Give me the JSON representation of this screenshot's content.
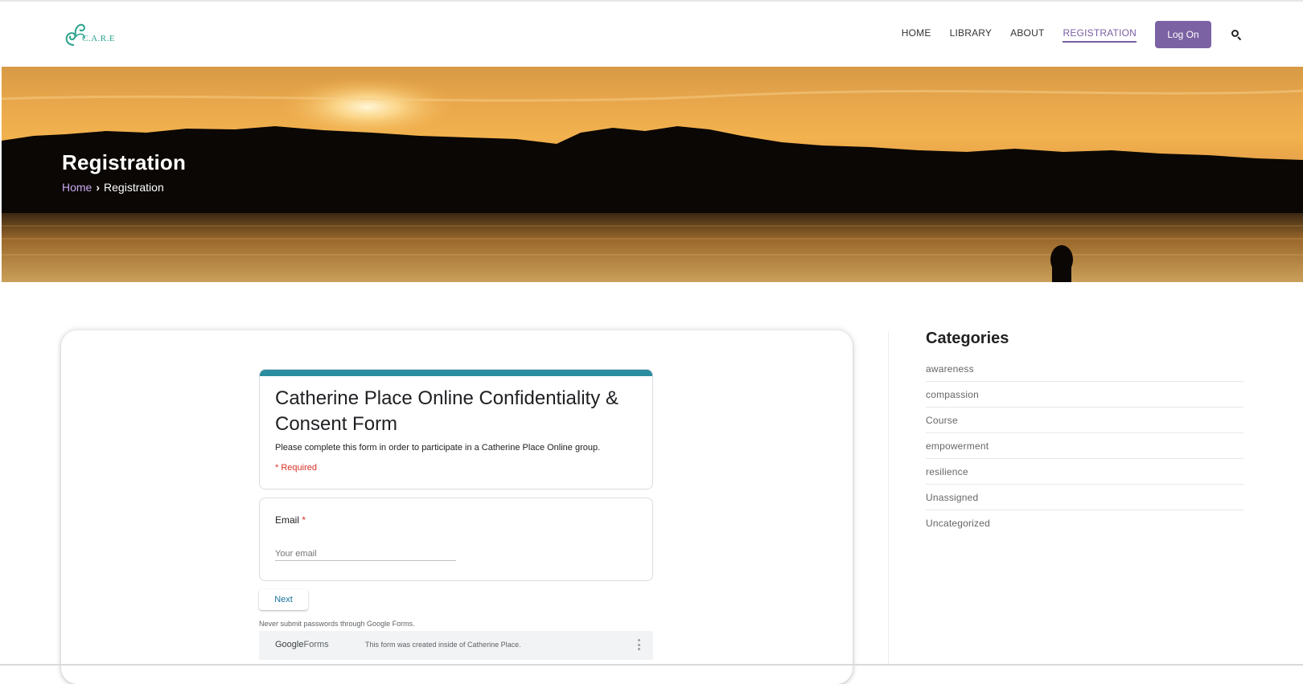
{
  "header": {
    "logo_text": "C.A.R.E",
    "nav": [
      "HOME",
      "LIBRARY",
      "ABOUT",
      "REGISTRATION"
    ],
    "active_nav": "REGISTRATION",
    "login_label": "Log On",
    "accent_color": "#7b62a3"
  },
  "hero": {
    "title": "Registration",
    "breadcrumb": {
      "home": "Home",
      "current": "Registration"
    }
  },
  "form": {
    "title": "Catherine Place Online Confidentiality & Consent Form",
    "description": "Please complete this form in order to participate in a Catherine Place Online group.",
    "required_note": "* Required",
    "question_label": "Email",
    "required_star": "*",
    "input_placeholder": "Your email",
    "next_label": "Next",
    "password_warning": "Never submit passwords through Google Forms.",
    "footer_brand_google": "Google",
    "footer_brand_forms": "Forms",
    "footer_note": "This form was created inside of Catherine Place.",
    "accent_color": "#2b8ca0"
  },
  "sidebar": {
    "title": "Categories",
    "categories": [
      "awareness",
      "compassion",
      "Course",
      "empowerment",
      "resilience",
      "Unassigned",
      "Uncategorized"
    ]
  }
}
